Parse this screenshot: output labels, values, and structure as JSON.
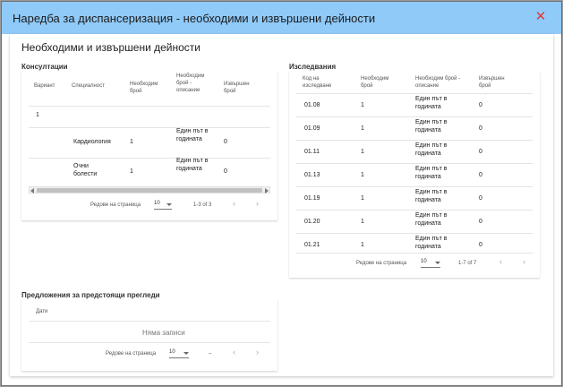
{
  "dialog": {
    "title": "Наредба за диспансеризация - необходими и извършени дейности",
    "close_symbol": "✕",
    "content_title": "Необходими и извършени дейности"
  },
  "consultations": {
    "title": "Консултации",
    "headers": {
      "variant": "Вариант",
      "specialty": "Специалност",
      "required_count": "Необходим брой",
      "required_desc": "Необходим брой - описание",
      "done_count": "Извършен брой"
    },
    "group_variant": "1",
    "rows": [
      {
        "specialty": "Кардиология",
        "required_count": "1",
        "required_desc": "Един път в годината",
        "done_count": "0"
      },
      {
        "specialty": "Очни болести",
        "required_count": "1",
        "required_desc": "Един път в годината",
        "done_count": "0"
      }
    ],
    "pager": {
      "rows_label": "Редове на страница",
      "page_size": "10",
      "range": "1-3 of 3",
      "prev": "‹",
      "next": "›"
    }
  },
  "investigations": {
    "title": "Изследвания",
    "headers": {
      "code": "Код на изследване",
      "required_count": "Необходим брой",
      "required_desc": "Необходим брой - описание",
      "done_count": "Извършен брой"
    },
    "rows": [
      {
        "code": "01.08",
        "required_count": "1",
        "required_desc": "Един път в годината",
        "done_count": "0"
      },
      {
        "code": "01.09",
        "required_count": "1",
        "required_desc": "Един път в годината",
        "done_count": "0"
      },
      {
        "code": "01.11",
        "required_count": "1",
        "required_desc": "Един път в годината",
        "done_count": "0"
      },
      {
        "code": "01.13",
        "required_count": "1",
        "required_desc": "Един път в годината",
        "done_count": "0"
      },
      {
        "code": "01.19",
        "required_count": "1",
        "required_desc": "Един път в годината",
        "done_count": "0"
      },
      {
        "code": "01.20",
        "required_count": "1",
        "required_desc": "Един път в годината",
        "done_count": "0"
      },
      {
        "code": "01.21",
        "required_count": "1",
        "required_desc": "Един път в годината",
        "done_count": "0"
      }
    ],
    "pager": {
      "rows_label": "Редове на страница",
      "page_size": "10",
      "range": "1-7 of 7",
      "prev": "‹",
      "next": "›"
    }
  },
  "proposals": {
    "title": "Предложения за предстоящи прегледи",
    "headers": {
      "dates": "Дати"
    },
    "empty_text": "Няма записи",
    "pager": {
      "rows_label": "Редове на страница",
      "page_size": "10",
      "range": "–",
      "prev": "‹",
      "next": "›"
    }
  },
  "colors": {
    "header_bg": "#90caf9",
    "close_icon": "#e53935"
  }
}
